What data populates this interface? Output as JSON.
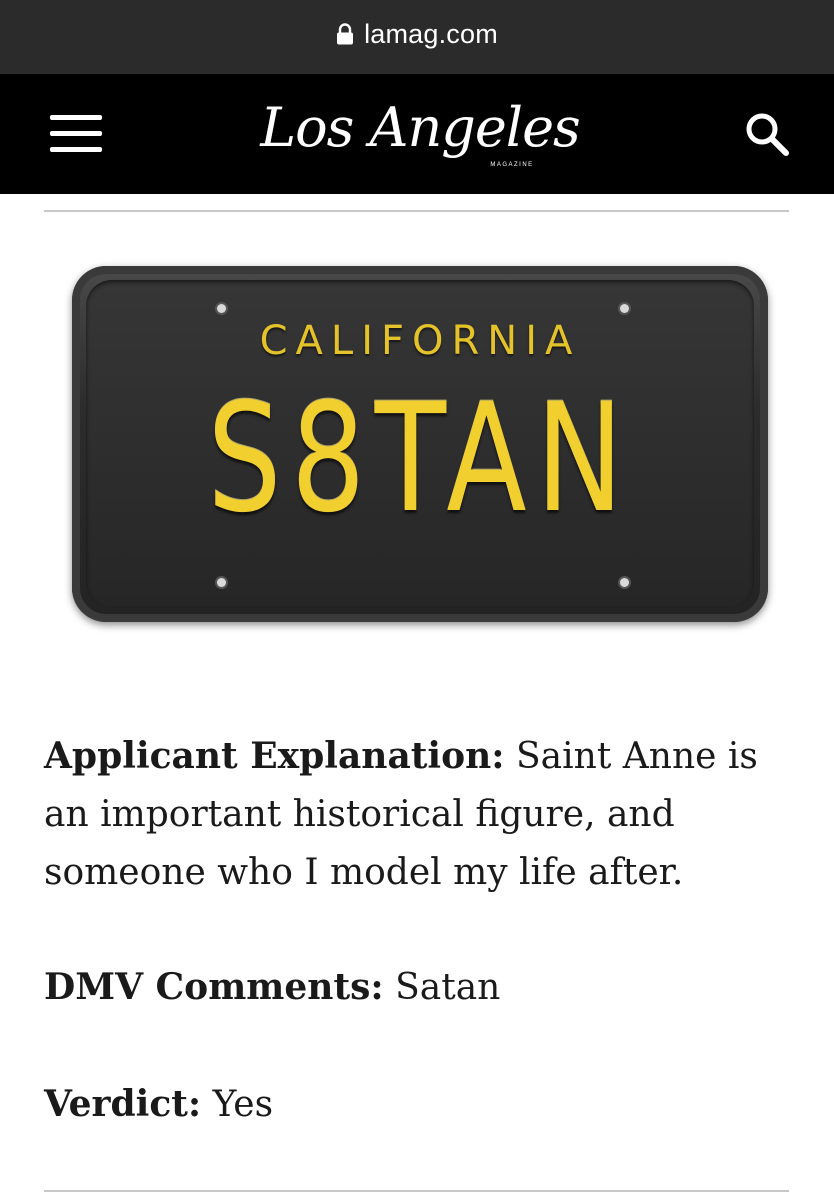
{
  "browser": {
    "url": "lamag.com",
    "lock_icon": "lock-icon"
  },
  "header": {
    "logo_text": "Los Angeles",
    "logo_subtext": "MAGAZINE",
    "menu_icon": "hamburger-menu-icon",
    "search_icon": "search-icon",
    "colors": {
      "background": "#000000",
      "foreground": "#ffffff"
    }
  },
  "plate": {
    "state": "CALIFORNIA",
    "number": "S8TAN",
    "colors": {
      "plate": "#2a2a2a",
      "lettering": "#f0cf2e"
    }
  },
  "article": {
    "explanation_label": "Applicant Explanation:",
    "explanation_text": " Saint Anne is an important historical figure, and someone who I model my life after.",
    "comments_label": "DMV Comments:",
    "comments_text": " Satan",
    "verdict_label": "Verdict:",
    "verdict_text": " Yes"
  }
}
